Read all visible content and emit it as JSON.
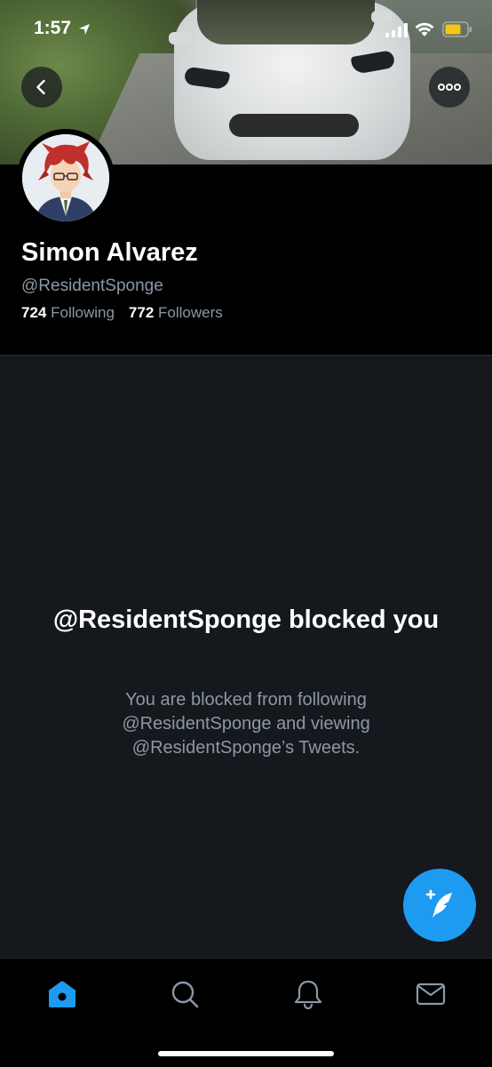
{
  "status_bar": {
    "time": "1:57"
  },
  "header": {
    "back_icon": "chevron-left-icon",
    "more_icon": "more-horizontal-icon"
  },
  "profile": {
    "name": "Simon Alvarez",
    "handle": "@ResidentSponge",
    "following_count": "724",
    "following_label": "Following",
    "followers_count": "772",
    "followers_label": "Followers"
  },
  "blocked": {
    "title": "@ResidentSponge blocked you",
    "description": "You are blocked from following @ResidentSponge and viewing @ResidentSponge’s Tweets."
  },
  "nav": {
    "items": [
      {
        "icon": "home-icon",
        "active": true
      },
      {
        "icon": "search-icon",
        "active": false
      },
      {
        "icon": "bell-icon",
        "active": false
      },
      {
        "icon": "mail-icon",
        "active": false
      }
    ]
  },
  "colors": {
    "accent": "#1d9bf0",
    "background": "#15181c",
    "secondary_text": "#8b98a5"
  }
}
